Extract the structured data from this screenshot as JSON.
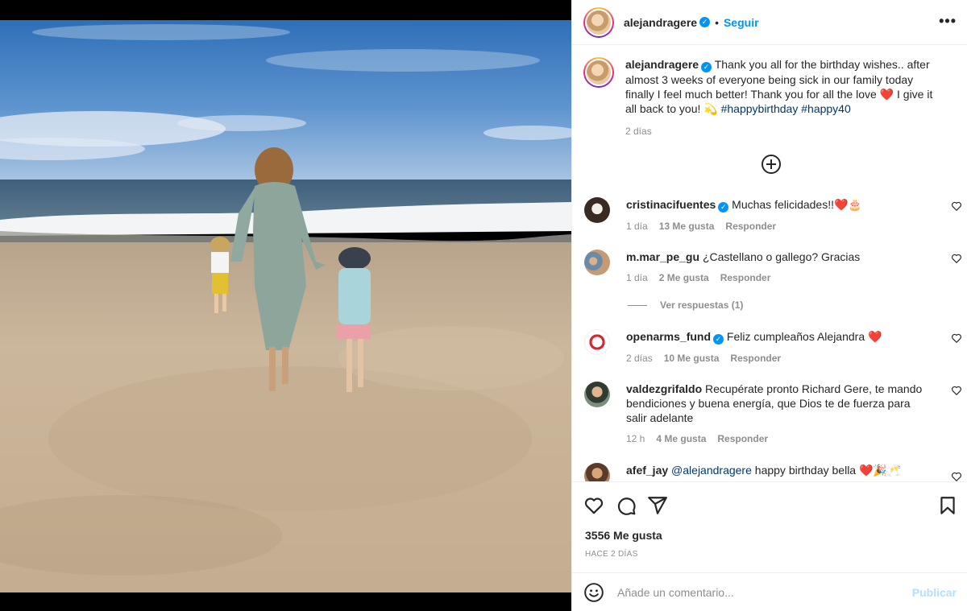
{
  "header": {
    "username": "alejandragere",
    "verified_mark": "✓",
    "separator": "•",
    "follow_label": "Seguir",
    "more_label": "•••"
  },
  "caption": {
    "username": "alejandragere",
    "text": "Thank you all for the birthday wishes.. after almost 3 weeks of everyone being sick in our family today finally I feel much better! Thank you for all the love ❤️ I give it all back to you! 💫",
    "hashtags": [
      "#happybirthday",
      "#happy40"
    ],
    "time": "2 días"
  },
  "comments": [
    {
      "username": "cristinacifuentes",
      "verified": true,
      "text": "Muchas felicidades!!❤️🎂",
      "time": "1 día",
      "likes": "13 Me gusta",
      "reply": "Responder"
    },
    {
      "username": "m.mar_pe_gu",
      "verified": false,
      "text": "¿Castellano o gallego? Gracias",
      "time": "1 día",
      "likes": "2 Me gusta",
      "reply": "Responder"
    },
    {
      "username": "openarms_fund",
      "verified": true,
      "text": "Feliz cumpleaños Alejandra ❤️",
      "time": "2 días",
      "likes": "10 Me gusta",
      "reply": "Responder"
    },
    {
      "username": "valdezgrifaldo",
      "verified": false,
      "text": "Recupérate pronto Richard Gere, te mando bendiciones y buena energía, que Dios te de fuerza para salir adelante",
      "time": "12 h",
      "likes": "4 Me gusta",
      "reply": "Responder"
    },
    {
      "username": "afef_jay",
      "verified": false,
      "mention": "@alejandragere",
      "text": "happy birthday bella ❤️🎉🥂"
    }
  ],
  "view_replies": "Ver respuestas (1)",
  "actions": {
    "icons": [
      "heart-icon",
      "comment-icon",
      "share-icon",
      "bookmark-icon"
    ],
    "likes": "3556 Me gusta",
    "time_ago": "HACE 2 DÍAS"
  },
  "composer": {
    "placeholder": "Añade un comentario...",
    "publish_label": "Publicar"
  },
  "colors": {
    "accent": "#0095f6",
    "publish_disabled": "#b2dffc",
    "muted": "#8e8e8e",
    "hashtag": "#00376b"
  }
}
